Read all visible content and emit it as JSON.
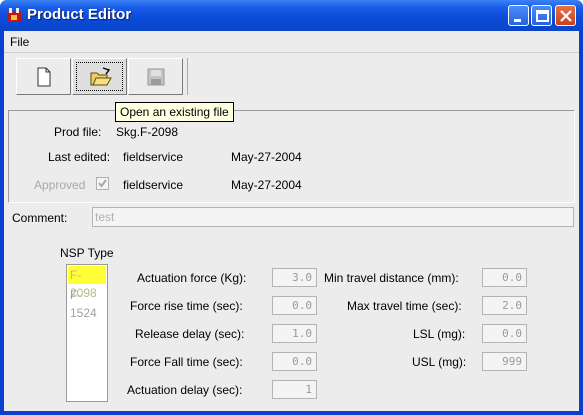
{
  "window": {
    "title": "Product Editor"
  },
  "menu": {
    "file": "File"
  },
  "toolbar": {
    "tooltip": "Open an existing file"
  },
  "info": {
    "prod_file_label": "Prod file:",
    "prod_file_value": "Skg.F-2098",
    "last_edited_label": "Last edited:",
    "last_edited_user": "fieldservice",
    "last_edited_date": "May-27-2004",
    "approved_label": "Approved",
    "approved_user": "fieldservice",
    "approved_date": "May-27-2004"
  },
  "comment": {
    "label": "Comment:",
    "value": "test"
  },
  "nsp": {
    "label": "NSP Type",
    "items": [
      "F-2098",
      "F-1524"
    ]
  },
  "params_left": {
    "actuation_force_label": "Actuation force (Kg):",
    "actuation_force_value": "3.0",
    "force_rise_label": "Force rise time (sec):",
    "force_rise_value": "0.0",
    "release_delay_label": "Release delay (sec):",
    "release_delay_value": "1.0",
    "force_fall_label": "Force Fall time (sec):",
    "force_fall_value": "0.0",
    "actuation_delay_label": "Actuation delay (sec):",
    "actuation_delay_value": "1"
  },
  "params_right": {
    "min_travel_label": "Min travel distance (mm):",
    "min_travel_value": "0.0",
    "max_travel_label": "Max travel time (sec):",
    "max_travel_value": "2.0",
    "lsl_label": "LSL (mg):",
    "lsl_value": "0.0",
    "usl_label": "USL (mg):",
    "usl_value": "999"
  },
  "colors": {
    "titlebar": "#0a4cd8",
    "nsp_selected": "#ffff33",
    "tooltip_bg": "#ffffe1"
  }
}
